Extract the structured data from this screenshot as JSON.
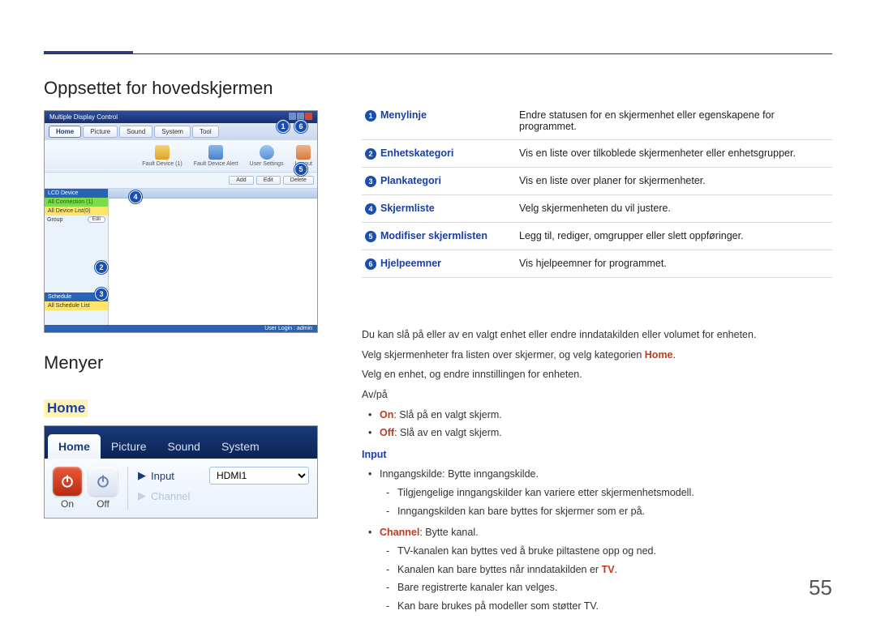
{
  "headings": {
    "section1": "Oppsettet for hovedskjermen",
    "section2": "Menyer",
    "section3": "Home"
  },
  "screenshot1": {
    "title": "Multiple Display Control",
    "menu": [
      "Home",
      "Picture",
      "Sound",
      "System",
      "Tool"
    ],
    "toolbar": [
      "Fault Device (1)",
      "Fault Device Alert",
      "User Settings",
      "Logout"
    ],
    "btnrow": [
      "Add",
      "Edit",
      "Delete"
    ],
    "side": {
      "hdr1": "LCD Device",
      "item1": "All Connection (1)",
      "item2": "All Device List(0)",
      "grouplabel": "Group",
      "groupbtn": "Edit",
      "hdr2": "Schedule",
      "item3": "All Schedule List"
    },
    "footer": "User Login : admin"
  },
  "screenshot2": {
    "tabs": [
      "Home",
      "Picture",
      "Sound",
      "System"
    ],
    "on": "On",
    "off": "Off",
    "input_label": "Input",
    "input_value": "HDMI1",
    "channel_label": "Channel"
  },
  "legend": [
    {
      "n": "1",
      "label": "Menylinje",
      "desc": "Endre statusen for en skjermenhet eller egenskapene for programmet."
    },
    {
      "n": "2",
      "label": "Enhetskategori",
      "desc": "Vis en liste over tilkoblede skjermenheter eller enhetsgrupper."
    },
    {
      "n": "3",
      "label": "Plankategori",
      "desc": "Vis en liste over planer for skjermenheter."
    },
    {
      "n": "4",
      "label": "Skjermliste",
      "desc": "Velg skjermenheten du vil justere."
    },
    {
      "n": "5",
      "label": "Modifiser skjermlisten",
      "desc": "Legg til, rediger, omgrupper eller slett oppføringer."
    },
    {
      "n": "6",
      "label": "Hjelpeemner",
      "desc": "Vis hjelpeemner for programmet."
    }
  ],
  "body": {
    "p1": "Du kan slå på eller av en valgt enhet eller endre inndatakilden eller volumet for enheten.",
    "p2_a": "Velg skjermenheter fra listen over skjermer, og velg kategorien ",
    "p2_b": "Home",
    "p2_c": ".",
    "p3": "Velg en enhet, og endre innstillingen for enheten.",
    "p4": "Av/på",
    "on_kw": "On",
    "on_txt": ": Slå på en valgt skjerm.",
    "off_kw": "Off",
    "off_txt": ": Slå av en valgt skjerm.",
    "input_hdr": "Input",
    "in1": "Inngangskilde: Bytte inngangskilde.",
    "in1a": "Tilgjengelige inngangskilder kan variere etter skjermenhetsmodell.",
    "in1b": "Inngangskilden kan bare byttes for skjermer som er på.",
    "ch_kw": "Channel",
    "ch_txt": ": Bytte kanal.",
    "ch1": "TV-kanalen kan byttes ved å bruke piltastene opp og ned.",
    "ch2a": "Kanalen kan bare byttes når inndatakilden er ",
    "ch2b": "TV",
    "ch2c": ".",
    "ch3": "Bare registrerte kanaler kan velges.",
    "ch4": "Kan bare brukes på modeller som støtter TV."
  },
  "page_number": "55"
}
